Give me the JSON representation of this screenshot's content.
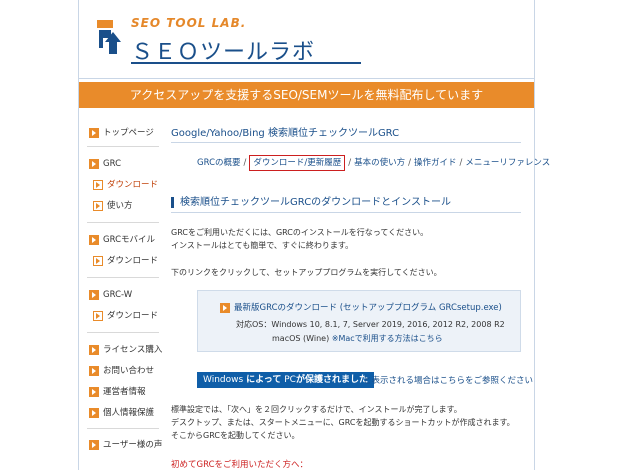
{
  "header": {
    "logo_small": "SEO TOOL LAB.",
    "logo_main": "ＳＥＯツールラボ"
  },
  "banner": "アクセスアップを支援するSEO/SEMツールを無料配布しています",
  "sidebar": {
    "items": [
      {
        "label": "トップページ"
      },
      {
        "label": "GRC"
      },
      {
        "label": "ダウンロード"
      },
      {
        "label": "使い方"
      },
      {
        "label": "GRCモバイル"
      },
      {
        "label": "ダウンロード"
      },
      {
        "label": "GRC-W"
      },
      {
        "label": "ダウンロード"
      },
      {
        "label": "ライセンス購入"
      },
      {
        "label": "お問い合わせ"
      },
      {
        "label": "運営者情報"
      },
      {
        "label": "個人情報保護"
      },
      {
        "label": "ユーザー様の声"
      }
    ]
  },
  "main": {
    "title1": "Google/Yahoo/Bing 検索順位チェックツールGRC",
    "nav": [
      {
        "label": "GRCの概要"
      },
      {
        "label": "ダウンロード/更新履歴"
      },
      {
        "label": "基本の使い方"
      },
      {
        "label": "操作ガイド"
      },
      {
        "label": "メニューリファレンス"
      }
    ],
    "nav_sep": "/",
    "title2": "検索順位チェックツールGRCのダウンロードとインストール",
    "para1_line1": "GRCをご利用いただくには、GRCのインストールを行なってください。",
    "para1_line2": "インストールはとても簡単で、すぐに終わります。",
    "para2": "下のリンクをクリックして、セットアッププログラムを実行してください。",
    "download": {
      "link": "最新版GRCのダウンロード (セットアッププログラム GRCsetup.exe)",
      "os_line1": "対応OS：Windows 10, 8.1, 7, Server 2019, 2016, 2012 R2, 2008 R2",
      "os_line2_prefix": "macOS (Wine)",
      "os_line2_link": "※Macで利用する方法はこちら"
    },
    "winbar": {
      "w1": "Windows",
      "w2": "によって",
      "w3": "PC",
      "w4": "が保護されました"
    },
    "winbar_after": "と表示される場合はこちらをご参照ください",
    "para3_line1": "標準設定では、「次へ」を２回クリックするだけで、インストールが完了します。",
    "para3_line2": "デスクトップ、または、スタートメニューに、GRCを起動するショートカットが作成されます。",
    "para3_line3": "そこからGRCを起動してください。",
    "footer_link": "初めてGRCをご利用いただく方へ："
  },
  "colors": {
    "accent_orange": "#e98b2a",
    "brand_blue": "#1a4f8a",
    "win_blue": "#0f5ea8",
    "highlight_red": "#cc1f1f"
  },
  "icons": {
    "sidebar_top": "orange-arrow-square-icon",
    "sidebar_sub": "outlined-arrow-square-icon",
    "download": "orange-arrow-square-icon"
  }
}
